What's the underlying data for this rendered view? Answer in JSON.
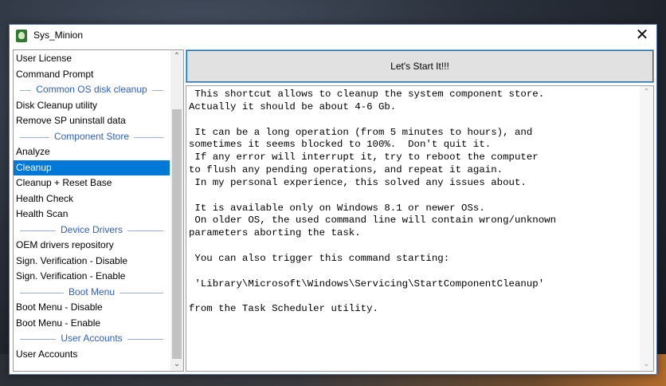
{
  "window": {
    "title": "Sys_Minion",
    "close_glyph": "✕"
  },
  "sidebar": {
    "rows": [
      {
        "type": "item",
        "label": "User License"
      },
      {
        "type": "item",
        "label": "Command Prompt"
      },
      {
        "type": "group",
        "label": "Common OS disk cleanup"
      },
      {
        "type": "item",
        "label": "Disk Cleanup utility"
      },
      {
        "type": "item",
        "label": "Remove SP uninstall data"
      },
      {
        "type": "group",
        "label": "Component Store"
      },
      {
        "type": "item",
        "label": "Analyze"
      },
      {
        "type": "item",
        "label": "Cleanup",
        "selected": true
      },
      {
        "type": "item",
        "label": "Cleanup + Reset Base"
      },
      {
        "type": "item",
        "label": "Health Check"
      },
      {
        "type": "item",
        "label": "Health Scan"
      },
      {
        "type": "group",
        "label": "Device Drivers"
      },
      {
        "type": "item",
        "label": "OEM drivers repository"
      },
      {
        "type": "item",
        "label": "Sign. Verification - Disable"
      },
      {
        "type": "item",
        "label": "Sign. Verification - Enable"
      },
      {
        "type": "group",
        "label": "Boot Menu"
      },
      {
        "type": "item",
        "label": "Boot Menu - Disable"
      },
      {
        "type": "item",
        "label": "Boot Menu - Enable"
      },
      {
        "type": "group",
        "label": "User Accounts"
      },
      {
        "type": "item",
        "label": "User Accounts"
      }
    ],
    "scroll_up_glyph": "⌃",
    "scroll_down_glyph": "⌄"
  },
  "main": {
    "start_button_label": "Let's Start It!!!",
    "output_text": " This shortcut allows to cleanup the system component store.\nActually it should be about 4-6 Gb.\n\n It can be a long operation (from 5 minutes to hours), and\nsometimes it seems blocked to 100%.  Don't quit it.\n If any error will interrupt it, try to reboot the computer\nto flush any pending operations, and repeat it again.\n In my personal experience, this solved any issues about.\n\n It is available only on Windows 8.1 or newer OSs.\n On older OS, the used command line will contain wrong/unknown\nparameters aborting the task.\n\n You can also trigger this command starting:\n\n 'Library\\Microsoft\\Windows\\Servicing\\StartComponentCleanup'\n\nfrom the Task Scheduler utility."
  },
  "colors": {
    "selection": "#0078d7",
    "group_heading": "#2e62c4"
  }
}
